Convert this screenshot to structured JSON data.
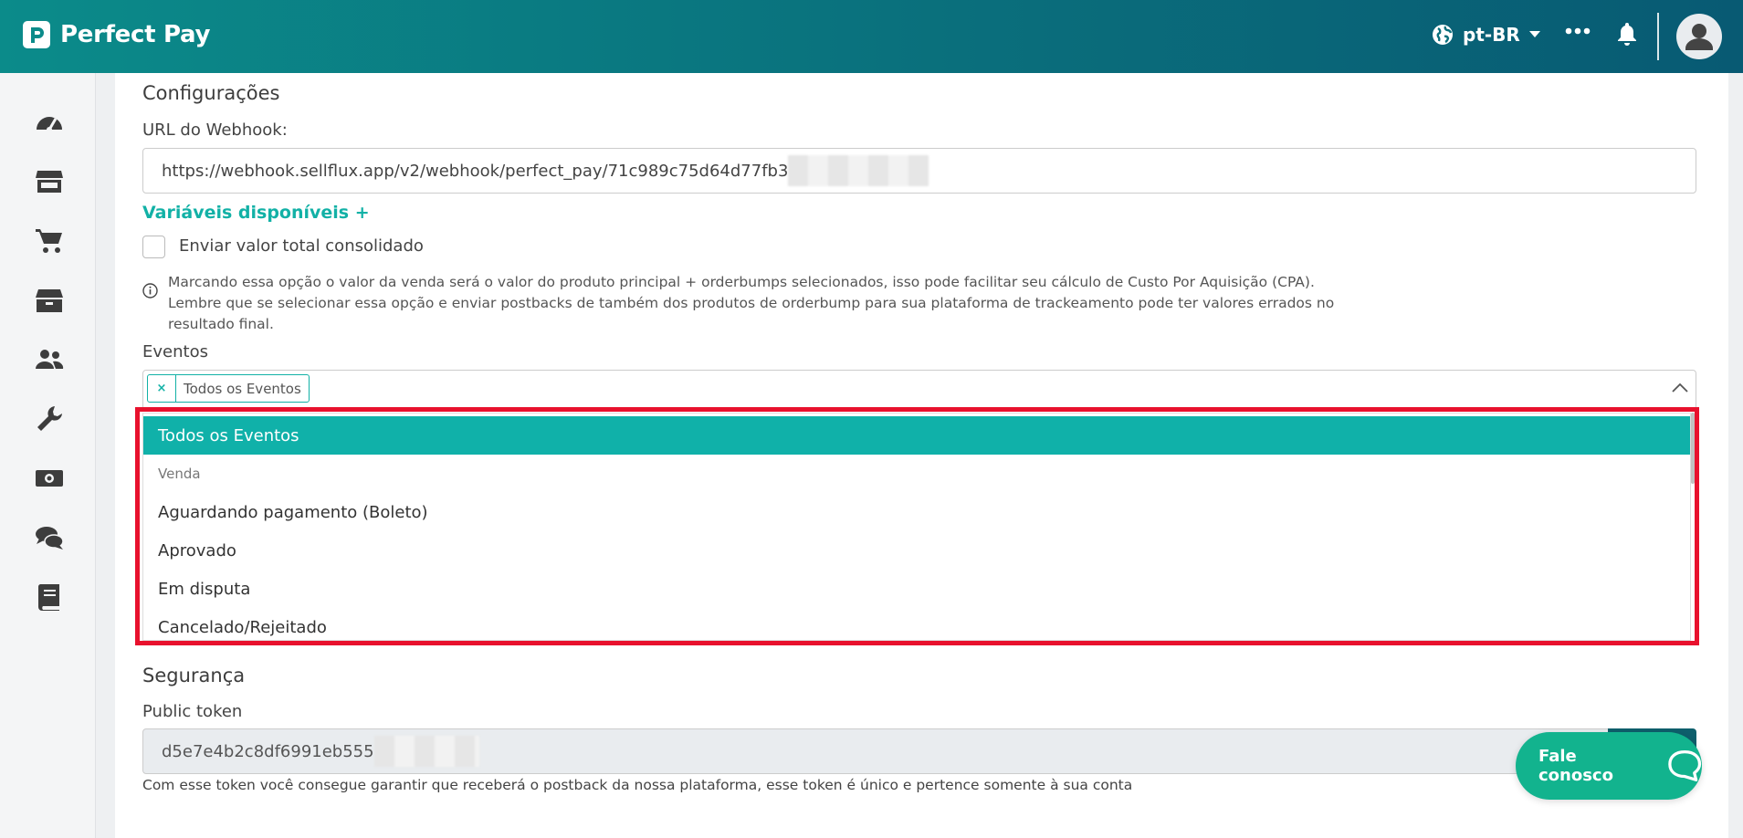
{
  "app": {
    "brand_name": "Perfect Pay",
    "language": "pt-BR",
    "accent_color": "#12b1a6",
    "header_gradient": [
      "#0b8b8a",
      "#085a73"
    ]
  },
  "sidebar": {
    "icons": [
      "dashboard-icon",
      "store-icon",
      "cart-icon",
      "box-icon",
      "users-icon",
      "wrench-icon",
      "money-icon",
      "chat-icon",
      "book-icon"
    ]
  },
  "configuracoes": {
    "title": "Configurações",
    "webhook_label": "URL do Webhook:",
    "webhook_value": "https://webhook.sellflux.app/v2/webhook/perfect_pay/71c989c75d64d77fb3",
    "variables_link": "Variáveis disponíveis +",
    "checkbox_label": "Enviar valor total consolidado",
    "info_text": "Marcando essa opção o valor da venda será o valor do produto principal + orderbumps selecionados, isso pode facilitar seu cálculo de Custo Por Aquisição (CPA). Lembre que se selecionar essa opção e enviar postbacks de também dos produtos de orderbump para sua plataforma de trackeamento pode ter valores errados no resultado final."
  },
  "eventos": {
    "label": "Eventos",
    "selected_tag": "Todos os Eventos",
    "tag_remove": "×",
    "options": [
      {
        "label": "Todos os Eventos",
        "type": "active"
      },
      {
        "label": "Venda",
        "type": "group"
      },
      {
        "label": "Aguardando pagamento (Boleto)",
        "type": "option"
      },
      {
        "label": "Aprovado",
        "type": "option"
      },
      {
        "label": "Em disputa",
        "type": "option"
      },
      {
        "label": "Cancelado/Rejeitado",
        "type": "option"
      }
    ],
    "highlight_color": "#e8112d"
  },
  "seguranca": {
    "title": "Segurança",
    "token_label": "Public token",
    "token_value": "d5e7e4b2c8df6991eb555",
    "help_text": "Com esse token você consegue garantir que receberá o postback da nossa plataforma, esse token é único e pertence somente à sua conta"
  },
  "chat": {
    "label": "Fale conosco"
  }
}
